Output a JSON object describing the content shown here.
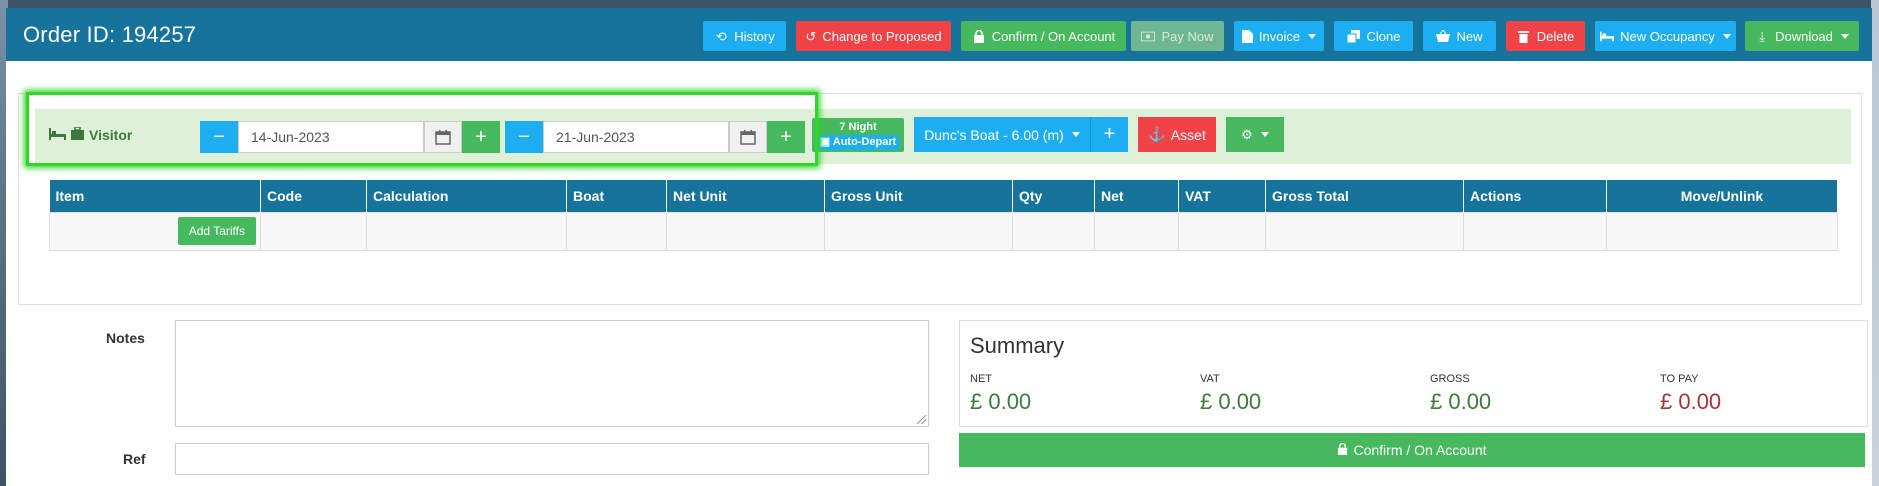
{
  "header": {
    "order_id": "Order ID: 194257",
    "buttons": {
      "history": "History",
      "change_to_proposed": "Change to Proposed",
      "confirm_on_account": "Confirm / On Account",
      "pay_now": "Pay Now",
      "invoice": "Invoice",
      "clone": "Clone",
      "new": "New",
      "delete": "Delete",
      "new_occupancy": "New Occupancy",
      "download": "Download"
    }
  },
  "occupancy": {
    "type_label": "Visitor",
    "start_date": "14-Jun-2023",
    "end_date": "21-Jun-2023",
    "nights": "7 Night",
    "auto_depart": "Auto-Depart",
    "boat": "Dunc's Boat - 6.00 (m)",
    "asset": "Asset",
    "plus": "+",
    "minus": "−"
  },
  "table": {
    "headers": [
      "Item",
      "Code",
      "Calculation",
      "Boat",
      "Net Unit",
      "Gross Unit",
      "Qty",
      "Net",
      "VAT",
      "Gross Total",
      "Actions",
      "Move/Unlink"
    ],
    "add_tariffs": "Add Tariffs"
  },
  "notes": {
    "label": "Notes",
    "ref_label": "Ref"
  },
  "summary": {
    "title": "Summary",
    "net_label": "NET",
    "net_value": "£ 0.00",
    "vat_label": "VAT",
    "vat_value": "£ 0.00",
    "gross_label": "GROSS",
    "gross_value": "£ 0.00",
    "to_pay_label": "TO PAY",
    "to_pay_value": "£ 0.00",
    "confirm_button": "Confirm / On Account"
  },
  "colors": {
    "header": "#16739b",
    "blue": "#1caef0",
    "red": "#f04247",
    "green": "#46b85e",
    "highlight": "#33d52a"
  }
}
